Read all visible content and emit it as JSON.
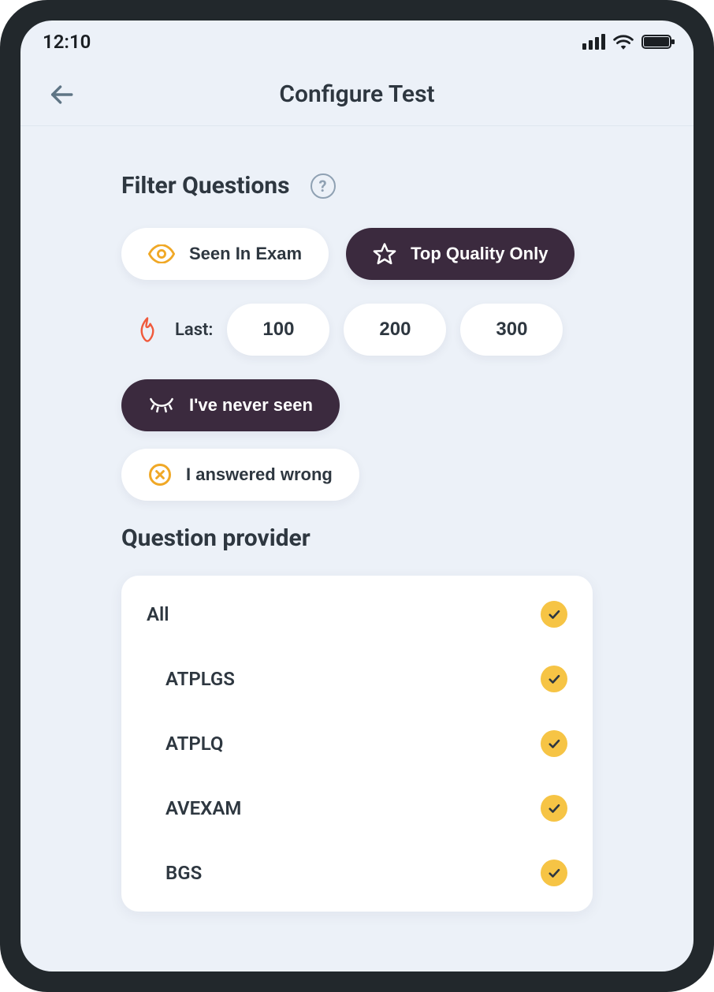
{
  "status": {
    "time": "12:10"
  },
  "header": {
    "title": "Configure Test"
  },
  "filter": {
    "title": "Filter Questions",
    "seen_in_exam": "Seen In Exam",
    "top_quality": "Top Quality Only",
    "last_label": "Last:",
    "last_options": {
      "o1": "100",
      "o2": "200",
      "o3": "300"
    },
    "never_seen": "I've never seen",
    "answered_wrong": "I answered wrong"
  },
  "provider": {
    "title": "Question provider",
    "items": [
      {
        "label": "All",
        "checked": true,
        "indent": false
      },
      {
        "label": "ATPLGS",
        "checked": true,
        "indent": true
      },
      {
        "label": "ATPLQ",
        "checked": true,
        "indent": true
      },
      {
        "label": "AVEXAM",
        "checked": true,
        "indent": true
      },
      {
        "label": "BGS",
        "checked": true,
        "indent": true
      }
    ]
  }
}
